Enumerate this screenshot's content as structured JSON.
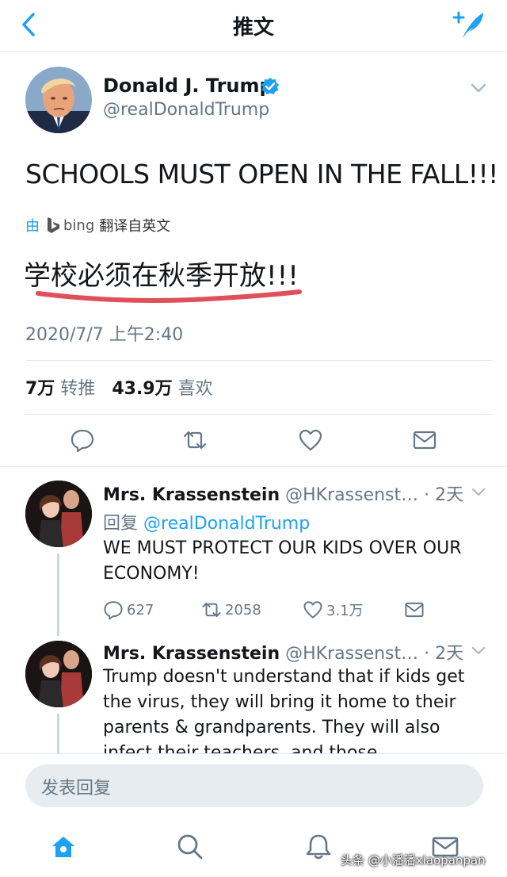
{
  "header": {
    "title": "推文"
  },
  "tweet": {
    "author_name": "Donald J. Trump",
    "author_handle": "@realDonaldTrump",
    "text": "SCHOOLS MUST OPEN IN THE FALL!!!",
    "translate": {
      "prefix": "由",
      "provider": "bing",
      "suffix": "翻译自英文"
    },
    "translated_text": "学校必须在秋季开放!!!",
    "timestamp": "2020/7/7 上午2:40",
    "stats": {
      "retweets_value": "7万",
      "retweets_label": "转推",
      "likes_value": "43.9万",
      "likes_label": "喜欢"
    }
  },
  "replies": [
    {
      "name": "Mrs. Krassenstein",
      "handle": "@HKrassenst…",
      "time": "· 2天",
      "reply_to_prefix": "回复",
      "reply_to": "@realDonaldTrump",
      "text": "WE MUST PROTECT OUR KIDS OVER OUR ECONOMY!",
      "replies_count": "627",
      "retweets_count": "2058",
      "likes_count": "3.1万"
    },
    {
      "name": "Mrs. Krassenstein",
      "handle": "@HKrassenst…",
      "time": "· 2天",
      "text": "Trump doesn't understand that if kids get the virus, they will bring it home to their parents & grandparents. They will also infect their teachers, and those"
    }
  ],
  "composer": {
    "placeholder": "发表回复"
  },
  "watermark": "头条 @小潘潘xiaopanpan",
  "colors": {
    "accent": "#1da1f2",
    "underline": "#e0505a",
    "text": "#14171a",
    "muted": "#657786"
  }
}
